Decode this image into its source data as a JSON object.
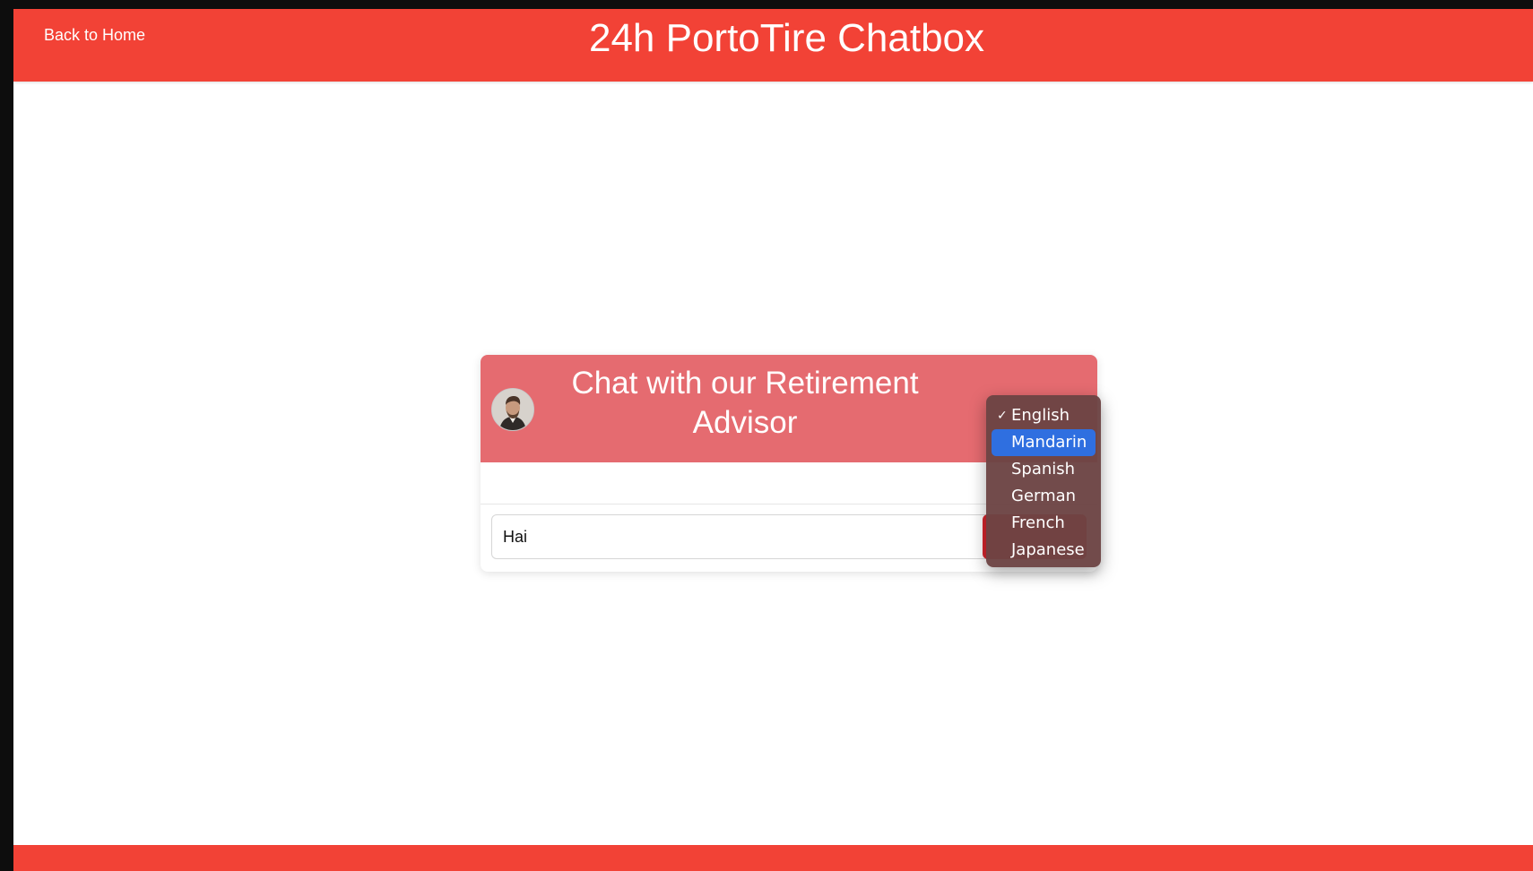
{
  "header": {
    "back_label": "Back to Home",
    "title": "24h PortoTire Chatbox",
    "color": "#f24236"
  },
  "chat": {
    "title": "Chat with our Retirement Advisor",
    "header_color": "#e56b70",
    "avatar_icon": "advisor-avatar",
    "input_value": "Hai"
  },
  "language_menu": {
    "selected": "English",
    "highlighted": "Mandarin",
    "items": [
      {
        "label": "English",
        "checked": true
      },
      {
        "label": "Mandarin",
        "highlighted": true
      },
      {
        "label": "Spanish"
      },
      {
        "label": "German"
      },
      {
        "label": "French"
      },
      {
        "label": "Japanese"
      }
    ],
    "highlight_color": "#2f6fe0"
  }
}
